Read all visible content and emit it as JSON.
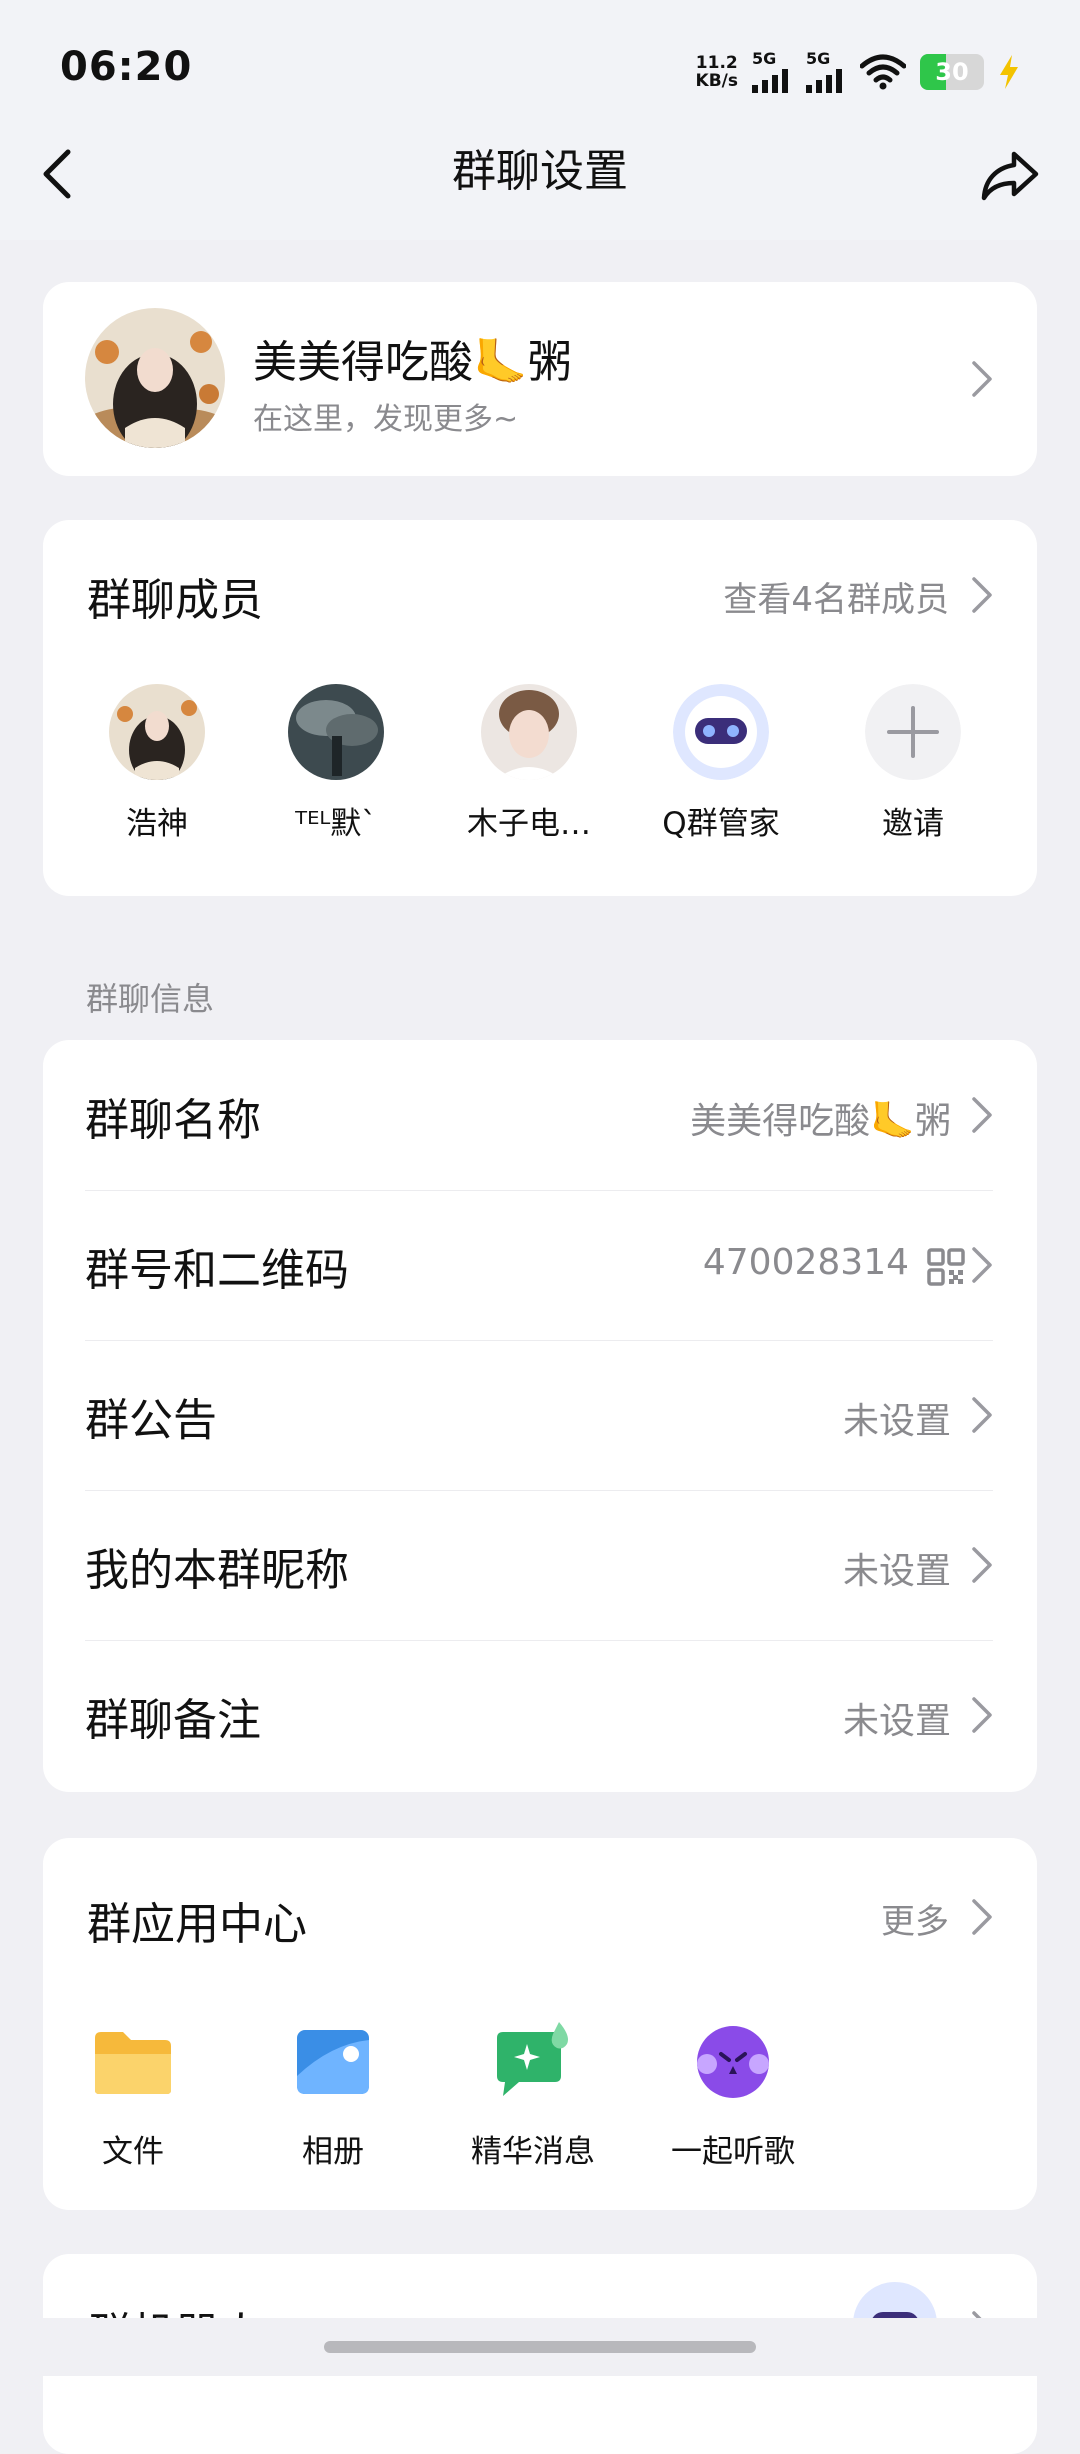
{
  "status_bar": {
    "time": "06:20",
    "net_speed_value": "11.2",
    "net_speed_unit": "KB/s",
    "signal1_label": "5G",
    "signal2_label": "5G",
    "battery_level": "30",
    "icons": [
      "signal-icon",
      "wifi-icon",
      "battery-icon",
      "charging-icon"
    ]
  },
  "nav": {
    "title": "群聊设置",
    "icons": [
      "back-icon",
      "share-icon"
    ]
  },
  "profile": {
    "name": "美美得吃酸🦶粥",
    "subtitle": "在这里，发现更多~"
  },
  "members": {
    "title": "群聊成员",
    "more_label": "查看4名群成员",
    "items": [
      {
        "name": "浩神"
      },
      {
        "name": "ᵀᴱᴸ默`"
      },
      {
        "name": "木子电…"
      },
      {
        "name": "Q群管家"
      },
      {
        "name": "邀请"
      }
    ]
  },
  "info_section": {
    "label": "群聊信息",
    "rows": [
      {
        "label": "群聊名称",
        "value": "美美得吃酸🦶粥"
      },
      {
        "label": "群号和二维码",
        "value": "470028314"
      },
      {
        "label": "群公告",
        "value": "未设置"
      },
      {
        "label": "我的本群昵称",
        "value": "未设置"
      },
      {
        "label": "群聊备注",
        "value": "未设置"
      }
    ]
  },
  "apps": {
    "title": "群应用中心",
    "more_label": "更多",
    "items": [
      {
        "name": "文件",
        "icon": "folder-icon"
      },
      {
        "name": "相册",
        "icon": "album-icon"
      },
      {
        "name": "精华消息",
        "icon": "essence-message-icon"
      },
      {
        "name": "一起听歌",
        "icon": "listen-together-icon"
      }
    ]
  },
  "partial_card": {
    "title": "群机器人"
  },
  "colors": {
    "background": "#f0f0f4",
    "card": "#ffffff",
    "secondary_text": "#8a8a8e",
    "battery_green": "#2fc64a"
  }
}
